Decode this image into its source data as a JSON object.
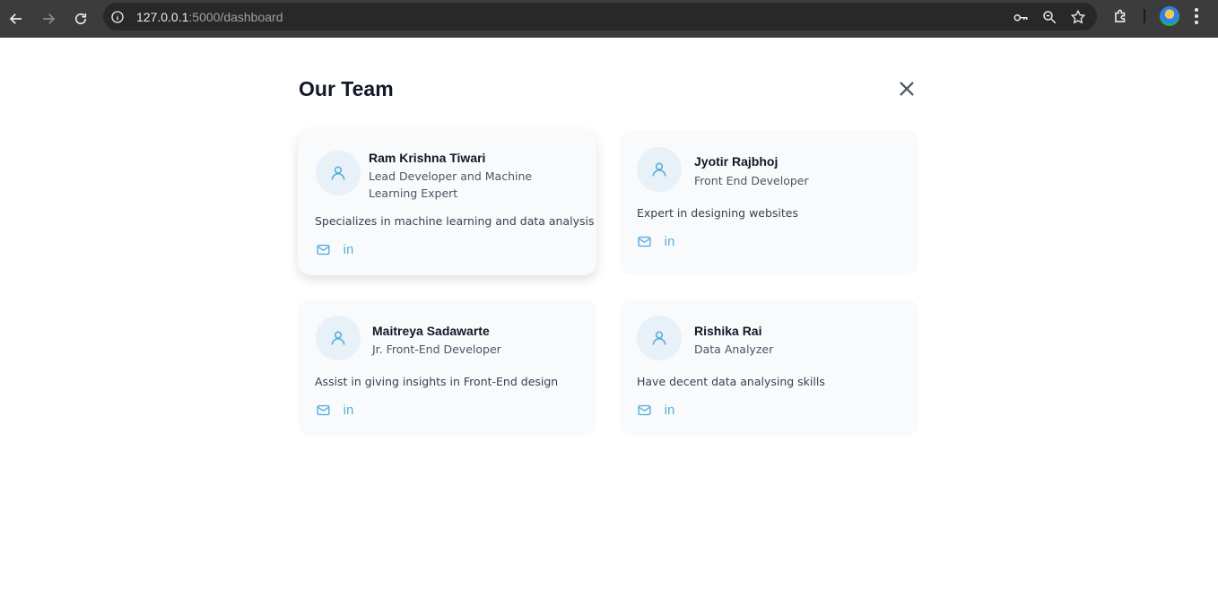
{
  "browser": {
    "url_host": "127.0.0.1",
    "url_path": ":5000/dashboard"
  },
  "page": {
    "title": "Our Team"
  },
  "team": [
    {
      "name": "Ram Krishna Tiwari",
      "role": "Lead Developer and Machine Learning Expert",
      "description": "Specializes in machine learning and data analysis"
    },
    {
      "name": "Jyotir Rajbhoj",
      "role": "Front End Developer",
      "description": "Expert in designing websites"
    },
    {
      "name": "Maitreya Sadawarte",
      "role": "Jr. Front-End Developer",
      "description": "Assist in giving insights in Front-End design"
    },
    {
      "name": "Rishika Rai",
      "role": "Data Analyzer",
      "description": "Have decent data analysing skills"
    }
  ],
  "social_labels": {
    "linkedin": "in"
  },
  "colors": {
    "accent": "#5aaedb",
    "card_bg": "#f8fafc"
  },
  "icons": {
    "avatar": "user-icon",
    "email": "mail-icon",
    "linkedin": "linkedin-icon",
    "close": "close-icon"
  }
}
